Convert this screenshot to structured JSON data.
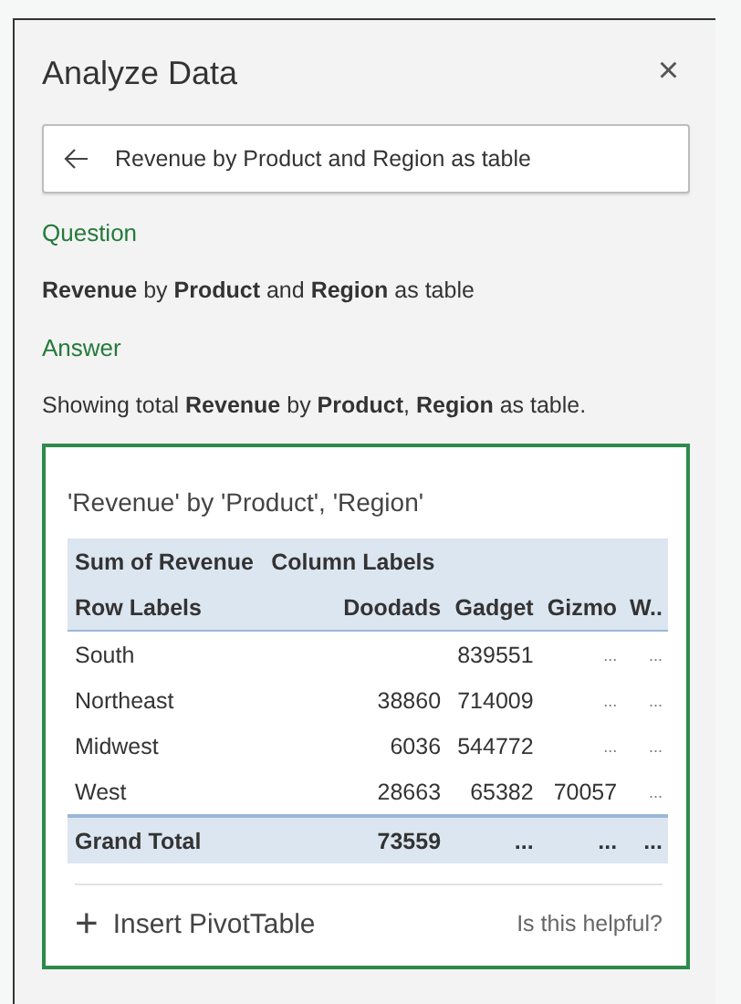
{
  "panel": {
    "title": "Analyze Data",
    "close": "×"
  },
  "search": {
    "value": "Revenue by Product and Region as table"
  },
  "question": {
    "heading": "Question",
    "text": "**Revenue** by **Product** and **Region** as table"
  },
  "answer": {
    "heading": "Answer",
    "text": "Showing total **Revenue** by **Product**, **Region** as table."
  },
  "card": {
    "title": "'Revenue' by 'Product', 'Region'",
    "header_rows": [
      [
        "Sum of Revenue",
        "Column Labels",
        "",
        "",
        ""
      ],
      [
        "Row Labels",
        "Doodads",
        "Gadget",
        "Gizmo",
        "W.."
      ]
    ],
    "rows": [
      {
        "kind": "data",
        "cells": [
          "South",
          "",
          "839551",
          "...",
          "..."
        ]
      },
      {
        "kind": "data",
        "cells": [
          "Northeast",
          "38860",
          "714009",
          "...",
          "..."
        ]
      },
      {
        "kind": "data",
        "cells": [
          "Midwest",
          "6036",
          "544772",
          "...",
          "..."
        ]
      },
      {
        "kind": "data",
        "cells": [
          "West",
          "28663",
          "65382",
          "70057",
          "..."
        ]
      },
      {
        "kind": "total",
        "cells": [
          "Grand Total",
          "73559",
          "...",
          "...",
          "..."
        ]
      }
    ],
    "insert_button": {
      "icon": "+",
      "label": "Insert PivotTable"
    },
    "feedback": "Is this helpful?"
  }
}
